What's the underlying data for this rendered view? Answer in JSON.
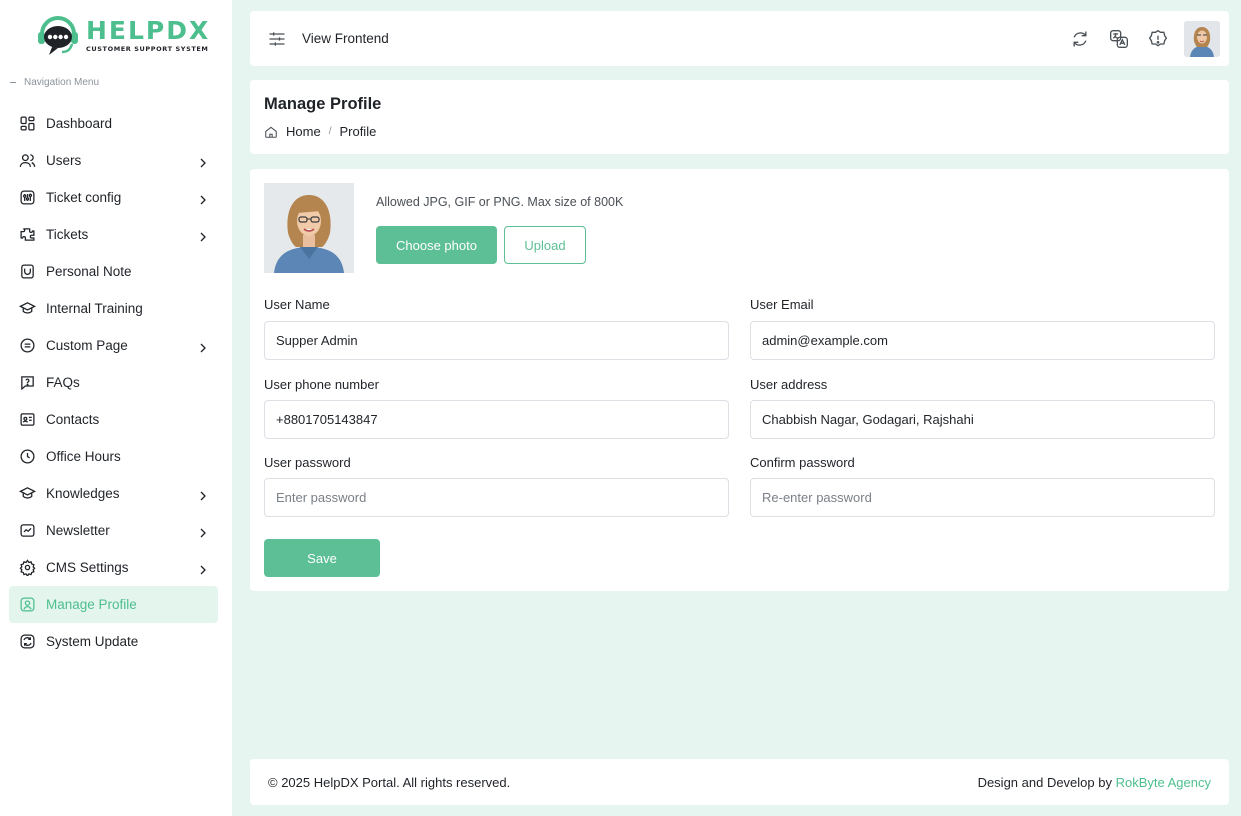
{
  "brand": {
    "title": "HELPDX",
    "subtitle": "CUSTOMER SUPPORT SYSTEM",
    "accent": "#4dbf8e"
  },
  "sidebar": {
    "caption": "Navigation Menu",
    "items": [
      {
        "label": "Dashboard",
        "icon": "dashboard-icon",
        "has_children": false
      },
      {
        "label": "Users",
        "icon": "users-icon",
        "has_children": true
      },
      {
        "label": "Ticket config",
        "icon": "ticket-config-icon",
        "has_children": true
      },
      {
        "label": "Tickets",
        "icon": "tickets-icon",
        "has_children": true
      },
      {
        "label": "Personal Note",
        "icon": "note-icon",
        "has_children": false
      },
      {
        "label": "Internal Training",
        "icon": "training-icon",
        "has_children": false
      },
      {
        "label": "Custom Page",
        "icon": "page-icon",
        "has_children": true
      },
      {
        "label": "FAQs",
        "icon": "faq-icon",
        "has_children": false
      },
      {
        "label": "Contacts",
        "icon": "contacts-icon",
        "has_children": false
      },
      {
        "label": "Office Hours",
        "icon": "clock-icon",
        "has_children": false
      },
      {
        "label": "Knowledges",
        "icon": "knowledge-icon",
        "has_children": true
      },
      {
        "label": "Newsletter",
        "icon": "newsletter-icon",
        "has_children": true
      },
      {
        "label": "CMS Settings",
        "icon": "gear-icon",
        "has_children": true
      },
      {
        "label": "Manage Profile",
        "icon": "profile-icon",
        "has_children": false,
        "active": true
      },
      {
        "label": "System Update",
        "icon": "update-icon",
        "has_children": false
      }
    ]
  },
  "topbar": {
    "view_frontend": "View Frontend"
  },
  "page": {
    "title": "Manage Profile",
    "breadcrumb": {
      "home": "Home",
      "separator": "/",
      "current": "Profile"
    }
  },
  "profile": {
    "allowed_text": "Allowed JPG, GIF or PNG. Max size of 800K",
    "choose_photo": "Choose photo",
    "upload": "Upload",
    "fields": {
      "user_name": {
        "label": "User Name",
        "value": "Supper Admin"
      },
      "user_email": {
        "label": "User Email",
        "value": "admin@example.com"
      },
      "user_phone": {
        "label": "User phone number",
        "value": "+8801705143847"
      },
      "user_address": {
        "label": "User address",
        "value": "Chabbish Nagar, Godagari, Rajshahi"
      },
      "user_password": {
        "label": "User password",
        "placeholder": "Enter password"
      },
      "confirm_password": {
        "label": "Confirm password",
        "placeholder": "Re-enter password"
      }
    },
    "save": "Save"
  },
  "footer": {
    "copyright": "© 2025 HelpDX Portal. All rights reserved.",
    "credit_prefix": "Design and Develop by",
    "credit_link": "RokByte Agency"
  }
}
